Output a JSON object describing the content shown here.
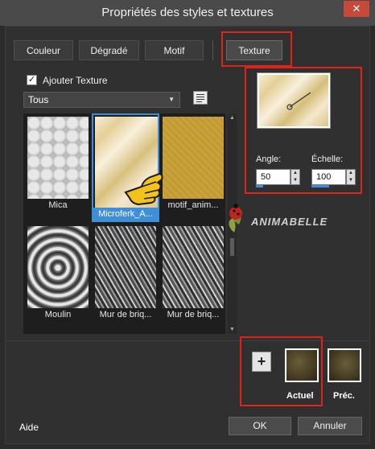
{
  "window": {
    "title": "Propriétés des styles et textures",
    "close_glyph": "✕"
  },
  "tabs": [
    {
      "label": "Couleur"
    },
    {
      "label": "Dégradé"
    },
    {
      "label": "Motif"
    },
    {
      "label": "Texture",
      "active": true
    }
  ],
  "texture_toggle": {
    "label": "Ajouter Texture",
    "checked": true
  },
  "category": {
    "selected": "Tous"
  },
  "thumbnails": [
    {
      "label": "Mica"
    },
    {
      "label": "Microferk_A...",
      "selected": true
    },
    {
      "label": "motif_anim..."
    },
    {
      "label": "Moulin"
    },
    {
      "label": "Mur de briq..."
    },
    {
      "label": "Mur de briq..."
    }
  ],
  "preview": {
    "angle_label": "Angle:",
    "angle_value": "50",
    "scale_label": "Échelle:",
    "scale_value": "100"
  },
  "watermark": {
    "text": "ANIMABELLE"
  },
  "swatches": {
    "add_glyph": "+",
    "current_label": "Actuel",
    "previous_label": "Préc."
  },
  "footer": {
    "help": "Aide",
    "ok": "OK",
    "cancel": "Annuler"
  },
  "colors": {
    "highlight": "#e0221b",
    "selection": "#3f8fd8",
    "texture_gold": "#c9a23a",
    "texture_cream": "#f2e7c8",
    "swatch": "#4e4426"
  }
}
